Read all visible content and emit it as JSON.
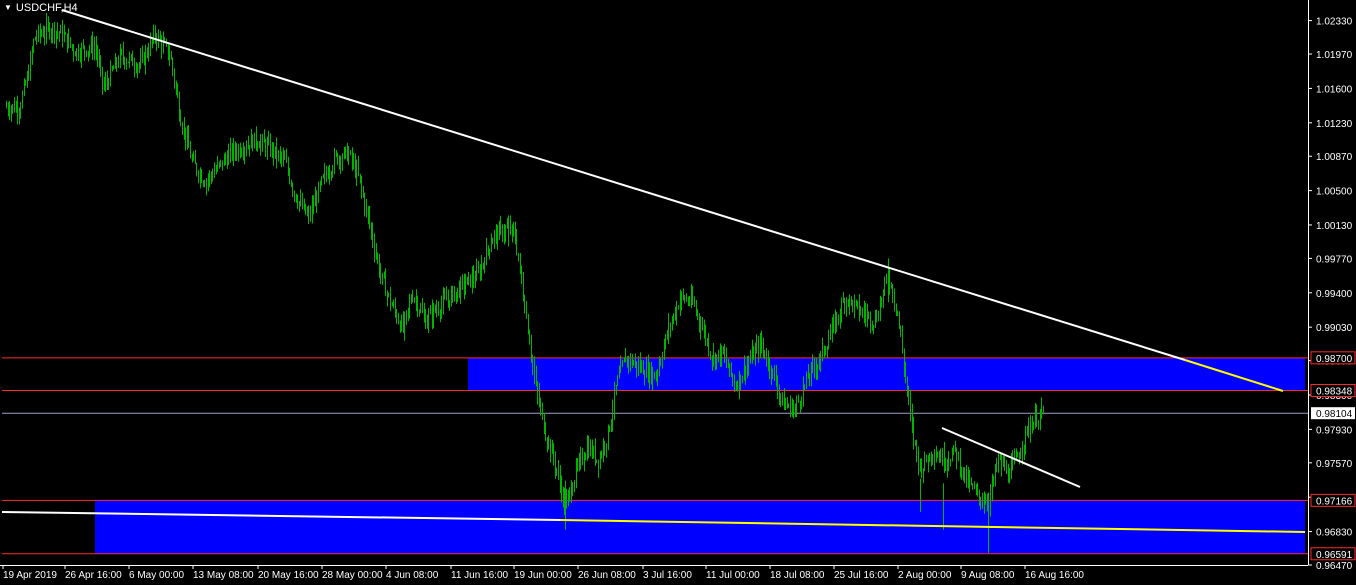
{
  "window": {
    "symbol_label": "USDCHF,H4",
    "menu_caret": "▼"
  },
  "colors": {
    "background": "#000000",
    "candles": "#00b400",
    "axis": "#ffffff",
    "zone_fill": "#0000ff",
    "level_line": "#ff2a2a",
    "bid_line": "#9aa0c8",
    "trendline": "#ffffff",
    "trendline_extension": "#ffff00"
  },
  "chart_data": {
    "type": "candlestick",
    "title": "USDCHF,H4",
    "ylim": [
      0.9647,
      1.0253
    ],
    "price_ticks": [
      1.0233,
      1.0197,
      1.016,
      1.0123,
      1.0087,
      1.005,
      1.0013,
      0.9977,
      0.994,
      0.9903,
      0.9867,
      0.983,
      0.9793,
      0.9757,
      0.972,
      0.9683,
      0.9647
    ],
    "time_labels": [
      "19 Apr 2019",
      "26 Apr 16:00",
      "6 May 00:00",
      "13 May 08:00",
      "20 May 16:00",
      "28 May 00:00",
      "4 Jun 08:00",
      "11 Jun 16:00",
      "19 Jun 00:00",
      "26 Jun 08:00",
      "3 Jul 16:00",
      "11 Jul 00:00",
      "18 Jul 08:00",
      "25 Jul 16:00",
      "2 Aug 00:00",
      "9 Aug 08:00",
      "16 Aug 16:00"
    ],
    "price_path": [
      [
        19,
        1.014
      ],
      [
        28,
        1.0175
      ],
      [
        34,
        1.0215
      ],
      [
        50,
        1.0225
      ],
      [
        62,
        1.0218
      ],
      [
        75,
        1.02
      ],
      [
        95,
        1.0205
      ],
      [
        103,
        1.016
      ],
      [
        120,
        1.0195
      ],
      [
        140,
        1.0185
      ],
      [
        155,
        1.0218
      ],
      [
        170,
        1.0195
      ],
      [
        180,
        1.013
      ],
      [
        192,
        1.008
      ],
      [
        205,
        1.006
      ],
      [
        230,
        1.009
      ],
      [
        255,
        1.0105
      ],
      [
        270,
        1.0095
      ],
      [
        285,
        1.008
      ],
      [
        295,
        1.0045
      ],
      [
        308,
        1.002
      ],
      [
        322,
        1.006
      ],
      [
        335,
        1.0085
      ],
      [
        348,
        1.009
      ],
      [
        358,
        1.0065
      ],
      [
        370,
        1.001
      ],
      [
        380,
        0.996
      ],
      [
        390,
        0.993
      ],
      [
        403,
        0.99
      ],
      [
        412,
        0.994
      ],
      [
        425,
        0.991
      ],
      [
        438,
        0.9925
      ],
      [
        450,
        0.9935
      ],
      [
        465,
        0.995
      ],
      [
        478,
        0.996
      ],
      [
        492,
        1.0
      ],
      [
        508,
        1.001
      ],
      [
        515,
        1.0
      ],
      [
        520,
        0.996
      ],
      [
        528,
        0.99
      ],
      [
        535,
        0.984
      ],
      [
        545,
        0.979
      ],
      [
        555,
        0.9755
      ],
      [
        565,
        0.971
      ],
      [
        575,
        0.9745
      ],
      [
        587,
        0.9775
      ],
      [
        598,
        0.976
      ],
      [
        608,
        0.979
      ],
      [
        616,
        0.984
      ],
      [
        625,
        0.987
      ],
      [
        640,
        0.986
      ],
      [
        655,
        0.985
      ],
      [
        668,
        0.99
      ],
      [
        680,
        0.9935
      ],
      [
        692,
        0.993
      ],
      [
        703,
        0.99
      ],
      [
        712,
        0.987
      ],
      [
        722,
        0.9875
      ],
      [
        735,
        0.984
      ],
      [
        748,
        0.9865
      ],
      [
        760,
        0.9885
      ],
      [
        772,
        0.9855
      ],
      [
        783,
        0.982
      ],
      [
        795,
        0.9815
      ],
      [
        808,
        0.985
      ],
      [
        820,
        0.987
      ],
      [
        832,
        0.99
      ],
      [
        845,
        0.9935
      ],
      [
        860,
        0.992
      ],
      [
        875,
        0.991
      ],
      [
        888,
        0.996
      ],
      [
        897,
        0.992
      ],
      [
        905,
        0.985
      ],
      [
        912,
        0.979
      ],
      [
        920,
        0.975
      ],
      [
        932,
        0.977
      ],
      [
        945,
        0.976
      ],
      [
        955,
        0.977
      ],
      [
        965,
        0.974
      ],
      [
        978,
        0.972
      ],
      [
        988,
        0.9715
      ],
      [
        998,
        0.976
      ],
      [
        1008,
        0.9745
      ],
      [
        1018,
        0.9765
      ],
      [
        1028,
        0.9795
      ],
      [
        1038,
        0.9808
      ],
      [
        1044,
        0.9811
      ]
    ],
    "annotations": {
      "resistance_zone": {
        "top": 0.987,
        "bottom": 0.98348
      },
      "support_zone": {
        "top": 0.97166,
        "bottom": 0.96591
      },
      "current_price": 0.98104,
      "level_badges": [
        "0.98700",
        "0.98348",
        "0.97166",
        "0.96591"
      ],
      "current_badge": "0.98104"
    }
  }
}
